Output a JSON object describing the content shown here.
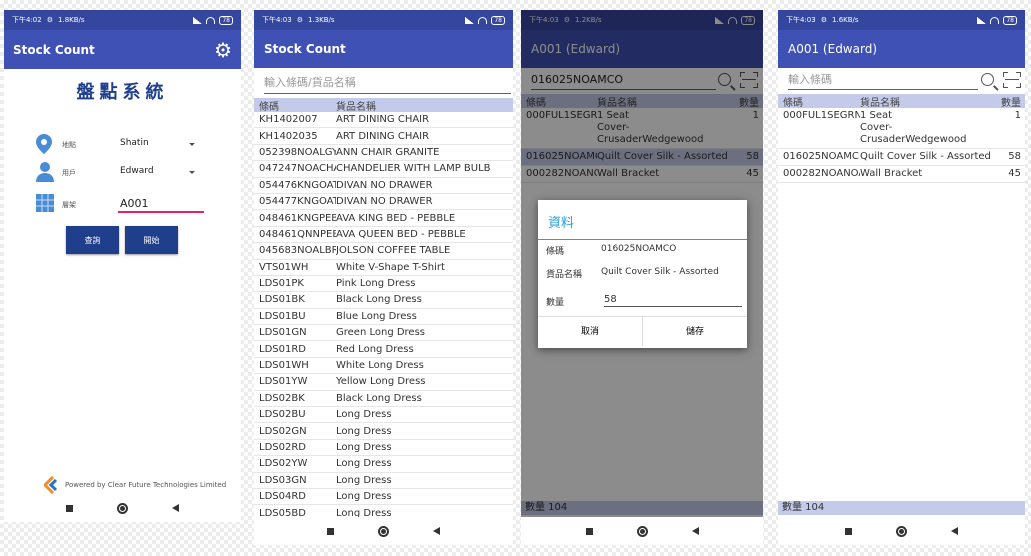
{
  "colors": {
    "primary": "#3f51b5",
    "status": "#35469f",
    "header_row": "#c4cbea",
    "button": "#1f3f8c",
    "accent_line": "#e91e63"
  },
  "screen1": {
    "status": {
      "time": "下午4:02",
      "icon": "gear-small",
      "speed": "1.8KB/s",
      "battery": "78"
    },
    "app_title": "Stock Count",
    "settings_icon": "gear-icon",
    "system_title": "盤點系統",
    "location": {
      "label": "地點",
      "value": "Shatin",
      "icon": "location-pin-icon"
    },
    "user": {
      "label": "用戶",
      "value": "Edward",
      "icon": "person-icon"
    },
    "shelf": {
      "label": "層架",
      "value": "A001",
      "icon": "shelf-grid-icon"
    },
    "query_button": "查詢",
    "start_button": "開始",
    "powered_by": "Powered by Clear Future Technologies Limited"
  },
  "screen2": {
    "status": {
      "time": "下午4:03",
      "speed": "1.3KB/s",
      "battery": "78"
    },
    "app_title": "Stock Count",
    "search_placeholder": "輸入條碼/貨品名稱",
    "columns": [
      "條碼",
      "貨品名稱"
    ],
    "rows": [
      [
        "KH1402007",
        "ART DINING CHAIR"
      ],
      [
        "KH1402035",
        "ART DINING CHAIR"
      ],
      [
        "052398NOALGY",
        "ANN CHAIR GRANITE"
      ],
      [
        "047247NOACHA",
        "CHANDELIER WITH LAMP BULB"
      ],
      [
        "054476KNGOAT",
        "DIVAN NO DRAWER"
      ],
      [
        "054477KNGOAT",
        "DIVAN NO DRAWER"
      ],
      [
        "048461KNGPEB",
        "AVA KING BED - PEBBLE"
      ],
      [
        "048461QNNPEB",
        "AVA QUEEN BED - PEBBLE"
      ],
      [
        "045683NOALBR",
        "JOLSON COFFEE TABLE"
      ],
      [
        "VTS01WH",
        "White V-Shape T-Shirt"
      ],
      [
        "LDS01PK",
        "Pink Long Dress"
      ],
      [
        "LDS01BK",
        "Black Long Dress"
      ],
      [
        "LDS01BU",
        "Blue Long Dress"
      ],
      [
        "LDS01GN",
        "Green Long Dress"
      ],
      [
        "LDS01RD",
        "Red Long Dress"
      ],
      [
        "LDS01WH",
        "White Long Dress"
      ],
      [
        "LDS01YW",
        "Yellow Long Dress"
      ],
      [
        "LDS02BK",
        "Black Long Dress"
      ],
      [
        "LDS02BU",
        "Long Dress"
      ],
      [
        "LDS02GN",
        "Long Dress"
      ],
      [
        "LDS02RD",
        "Long Dress"
      ],
      [
        "LDS02YW",
        "Long Dress"
      ],
      [
        "LDS03GN",
        "Long Dress"
      ],
      [
        "LDS04RD",
        "Long Dress"
      ],
      [
        "LDS05BD",
        "Long Dress"
      ]
    ]
  },
  "screen3": {
    "status": {
      "time": "下午4:03",
      "speed": "1.2KB/s",
      "battery": "78"
    },
    "app_title": "A001 (Edward)",
    "search_value": "016025NOAMCO",
    "columns": [
      "條碼",
      "貨品名稱",
      "數量"
    ],
    "rows": [
      {
        "code": "000FUL1SEGRN",
        "name_line1": "1 Seat",
        "name_line2": "Cover-CrusaderWedgewood",
        "qty": "1"
      },
      {
        "code": "016025NOAMC",
        "name_line1": "Quilt Cover Silk - Assorted",
        "name_line2": "",
        "qty": "58"
      },
      {
        "code": "000282NOANOA",
        "name_line1": "Wall Bracket",
        "name_line2": "",
        "qty": "45"
      }
    ],
    "dialog": {
      "title": "資料",
      "barcode_label": "條碼",
      "barcode_value": "016025NOAMCO",
      "name_label": "貨品名稱",
      "name_value": "Quilt Cover Silk - Assorted",
      "qty_label": "數量",
      "qty_value": "58",
      "cancel": "取消",
      "save": "儲存"
    },
    "footer": "數量 104"
  },
  "screen4": {
    "status": {
      "time": "下午4:03",
      "speed": "1.6KB/s",
      "battery": "78"
    },
    "app_title": "A001 (Edward)",
    "search_placeholder": "輸入條碼",
    "columns": [
      "條碼",
      "貨品名稱",
      "數量"
    ],
    "rows": [
      {
        "code": "000FUL1SEGRN",
        "name_line1": "1 Seat",
        "name_line2": "Cover-CrusaderWedgewood",
        "qty": "1"
      },
      {
        "code": "016025NOAMC",
        "name_line1": "Quilt Cover Silk - Assorted",
        "name_line2": "",
        "qty": "58"
      },
      {
        "code": "000282NOANOA",
        "name_line1": "Wall Bracket",
        "name_line2": "",
        "qty": "45"
      }
    ],
    "footer": "數量 104"
  }
}
